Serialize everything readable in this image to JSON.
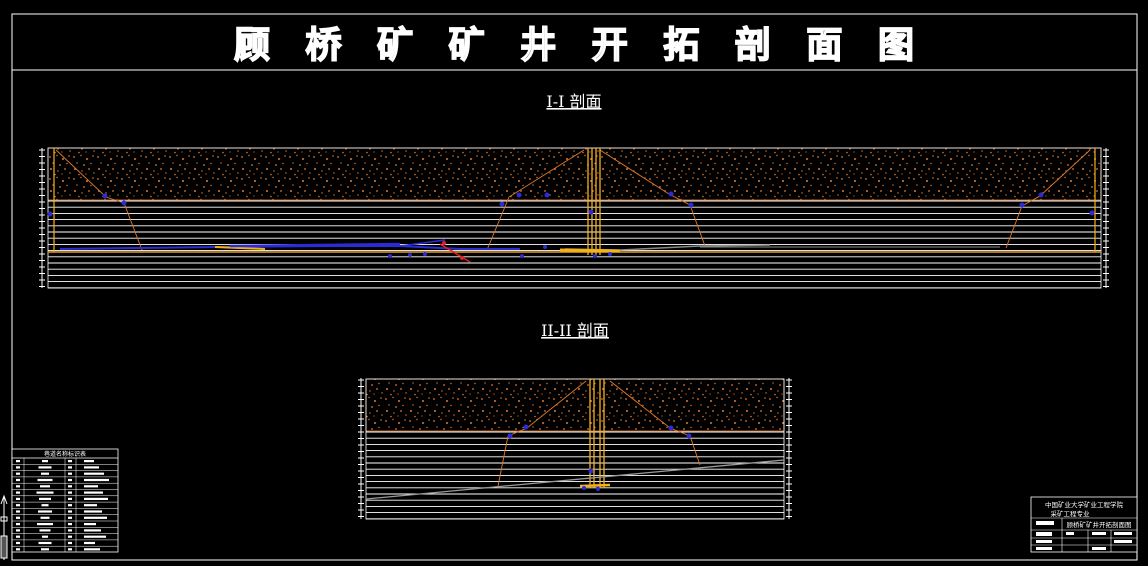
{
  "drawing": {
    "title": "顾桥矿矿井开拓剖面图",
    "section_1_title": "I-I 剖面",
    "section_2_title": "II-II 剖面"
  },
  "legend": {
    "title": "巷道名称标识表"
  },
  "title_block": {
    "org": "中国矿业大学矿业工程学院",
    "major": "采矿工程专业",
    "drawing_name": "顾桥矿矿井开拓剖面图"
  },
  "colors": {
    "background": "#000000",
    "frame": "#ffffff",
    "strata_fill": "#e07a2c",
    "shaft": "#f5b31a",
    "roadway": "#2b2bd8",
    "marker": "#e02020"
  }
}
